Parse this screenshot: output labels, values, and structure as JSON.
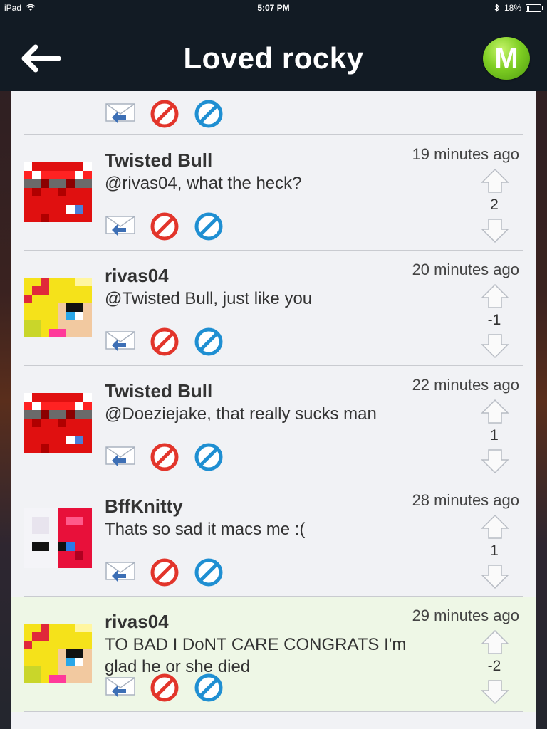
{
  "status_bar": {
    "device": "iPad",
    "time": "5:07 PM",
    "battery": "18%",
    "battery_level": 0.18
  },
  "header": {
    "title": "Loved rocky",
    "logo_letter": "M"
  },
  "icons": {
    "reply": "reply-mail-icon",
    "flag": "flag-no-icon",
    "block": "block-icon",
    "up": "vote-up-icon",
    "down": "vote-down-icon"
  },
  "comments": [
    {
      "author": "Twisted Bull",
      "text": "@rivas04, what the heck?",
      "time": "19 minutes ago",
      "score": "2",
      "avatar": "red"
    },
    {
      "author": "rivas04",
      "text": "@Twisted Bull, just like you",
      "time": "20 minutes ago",
      "score": "-1",
      "avatar": "yellow"
    },
    {
      "author": "Twisted Bull",
      "text": "@Doeziejake, that really sucks man",
      "time": "22 minutes ago",
      "score": "1",
      "avatar": "red"
    },
    {
      "author": "BffKnitty",
      "text": "Thats so sad it macs me :(",
      "time": "28 minutes ago",
      "score": "1",
      "avatar": "white"
    },
    {
      "author": "rivas04",
      "text": "TO BAD I DoNT CARE CONGRATS I'm glad he or she died",
      "time": "29 minutes ago",
      "score": "-2",
      "avatar": "yellow",
      "highlighted": true
    }
  ]
}
